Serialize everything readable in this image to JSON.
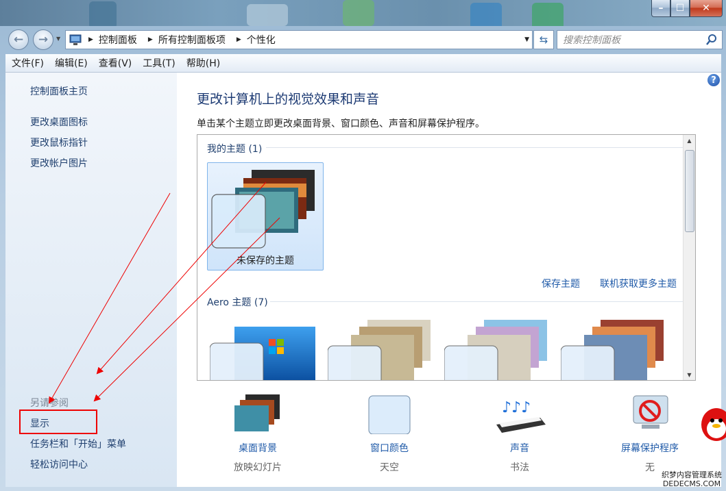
{
  "breadcrumb": [
    "控制面板",
    "所有控制面板项",
    "个性化"
  ],
  "search": {
    "placeholder": "搜索控制面板"
  },
  "menu": [
    "文件(F)",
    "编辑(E)",
    "查看(V)",
    "工具(T)",
    "帮助(H)"
  ],
  "sidebar": {
    "home": "控制面板主页",
    "links": [
      "更改桌面图标",
      "更改鼠标指针",
      "更改帐户图片"
    ],
    "see_also_heading": "另请参阅",
    "see_also": [
      "显示",
      "任务栏和「开始」菜单",
      "轻松访问中心"
    ]
  },
  "main": {
    "title": "更改计算机上的视觉效果和声音",
    "subtitle": "单击某个主题立即更改桌面背景、窗口颜色、声音和屏幕保护程序。",
    "my_themes_heading": "我的主题 (1)",
    "unsaved_theme": "未保存的主题",
    "save_theme": "保存主题",
    "get_more_themes": "联机获取更多主题",
    "aero_heading": "Aero 主题 (7)"
  },
  "bottom": [
    {
      "label": "桌面背景",
      "value": "放映幻灯片",
      "icon": "desktop-background-icon"
    },
    {
      "label": "窗口颜色",
      "value": "天空",
      "icon": "window-color-icon"
    },
    {
      "label": "声音",
      "value": "书法",
      "icon": "sound-icon"
    },
    {
      "label": "屏幕保护程序",
      "value": "无",
      "icon": "screensaver-icon"
    }
  ],
  "watermark": {
    "line1": "织梦内容管理系统",
    "line2": "DEDECMS.COM"
  },
  "colors": {
    "link": "#1f5aa8",
    "heading": "#1c3a73",
    "highlight": "#e00000"
  }
}
